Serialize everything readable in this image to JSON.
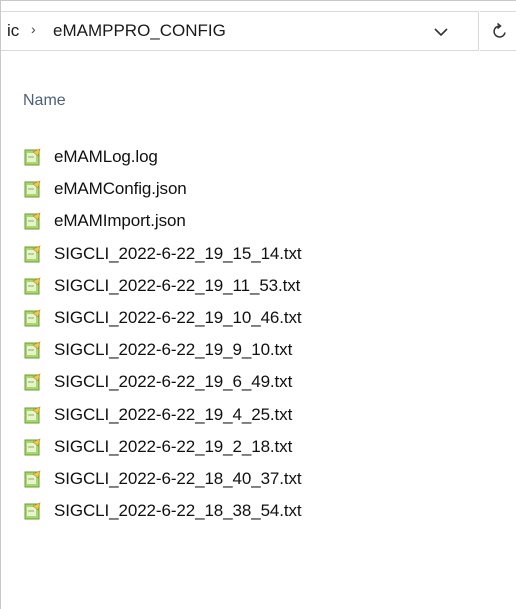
{
  "address_bar": {
    "crumb_prefix": "ic",
    "separator": "›",
    "current_folder": "eMAMPPRO_CONFIG",
    "dropdown_icon": "chevron-down-icon",
    "refresh_icon": "refresh-icon"
  },
  "columns": {
    "name_header": "Name"
  },
  "files": [
    {
      "name": "eMAMLog.log",
      "icon": "text-file-icon"
    },
    {
      "name": "eMAMConfig.json",
      "icon": "text-file-icon"
    },
    {
      "name": "eMAMImport.json",
      "icon": "text-file-icon"
    },
    {
      "name": "SIGCLI_2022-6-22_19_15_14.txt",
      "icon": "text-file-icon"
    },
    {
      "name": "SIGCLI_2022-6-22_19_11_53.txt",
      "icon": "text-file-icon"
    },
    {
      "name": "SIGCLI_2022-6-22_19_10_46.txt",
      "icon": "text-file-icon"
    },
    {
      "name": "SIGCLI_2022-6-22_19_9_10.txt",
      "icon": "text-file-icon"
    },
    {
      "name": "SIGCLI_2022-6-22_19_6_49.txt",
      "icon": "text-file-icon"
    },
    {
      "name": "SIGCLI_2022-6-22_19_4_25.txt",
      "icon": "text-file-icon"
    },
    {
      "name": "SIGCLI_2022-6-22_19_2_18.txt",
      "icon": "text-file-icon"
    },
    {
      "name": "SIGCLI_2022-6-22_18_40_37.txt",
      "icon": "text-file-icon"
    },
    {
      "name": "SIGCLI_2022-6-22_18_38_54.txt",
      "icon": "text-file-icon"
    }
  ],
  "colors": {
    "header_text": "#4c607a",
    "icon_green": "#8cc63f",
    "icon_yellow": "#f2c94c"
  }
}
